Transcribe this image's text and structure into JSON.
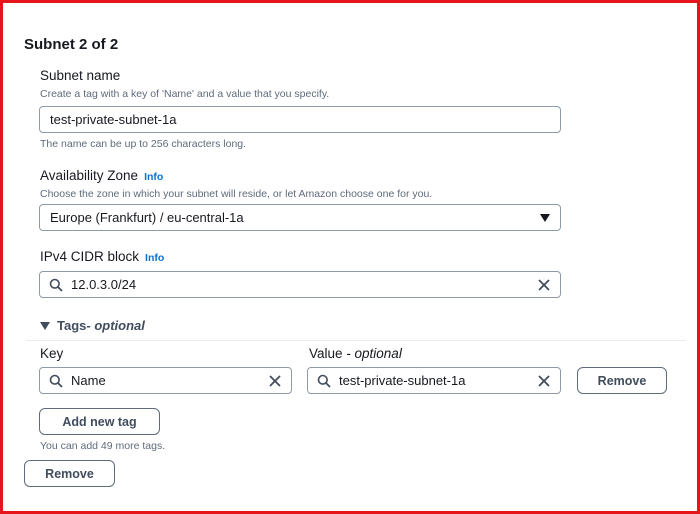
{
  "section": {
    "title": "Subnet 2 of 2"
  },
  "subnet_name": {
    "label": "Subnet name",
    "description": "Create a tag with a key of 'Name' and a value that you specify.",
    "value": "test-private-subnet-1a",
    "hint": "The name can be up to 256 characters long."
  },
  "availability_zone": {
    "label": "Availability Zone",
    "info": "Info",
    "description": "Choose the zone in which your subnet will reside, or let Amazon choose one for you.",
    "selected": "Europe (Frankfurt) / eu-central-1a"
  },
  "cidr": {
    "label": "IPv4 CIDR block",
    "info": "Info",
    "value": "12.0.3.0/24"
  },
  "tags": {
    "header_label": "Tags",
    "header_optional": " - optional",
    "key_label": "Key",
    "value_label": "Value",
    "value_optional": " - optional",
    "rows": [
      {
        "key": "Name",
        "value": "test-private-subnet-1a",
        "remove_label": "Remove"
      }
    ],
    "add_label": "Add new tag",
    "remaining_text": "You can add 49 more tags."
  },
  "remove_subnet_label": "Remove",
  "icons": {
    "search": "search-icon",
    "clear": "close-icon",
    "caret": "caret-down-icon",
    "expand": "triangle-down-icon"
  },
  "colors": {
    "frame": "#e8141b",
    "info": "#0972d3",
    "text": "#16191f",
    "muted": "#5f6b7a"
  }
}
